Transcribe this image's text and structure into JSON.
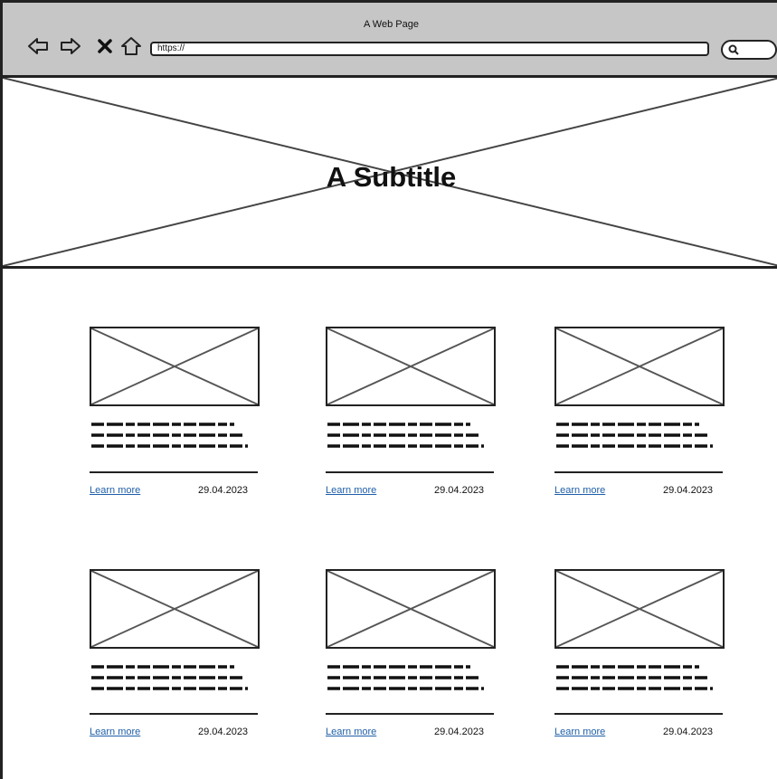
{
  "browser": {
    "title": "A Web Page",
    "address": "https://"
  },
  "hero": {
    "title": "A Subtitle"
  },
  "cards": [
    {
      "link": "Learn more",
      "date": "29.04.2023"
    },
    {
      "link": "Learn more",
      "date": "29.04.2023"
    },
    {
      "link": "Learn more",
      "date": "29.04.2023"
    },
    {
      "link": "Learn more",
      "date": "29.04.2023"
    },
    {
      "link": "Learn more",
      "date": "29.04.2023"
    },
    {
      "link": "Learn more",
      "date": "29.04.2023"
    }
  ],
  "icons": [
    "back-arrow-icon",
    "forward-arrow-icon",
    "close-icon",
    "home-icon",
    "search-icon",
    "image-placeholder-icon"
  ],
  "colors": {
    "chrome": "#c6c6c6",
    "link": "#1f5fa8",
    "stroke": "#222222"
  }
}
